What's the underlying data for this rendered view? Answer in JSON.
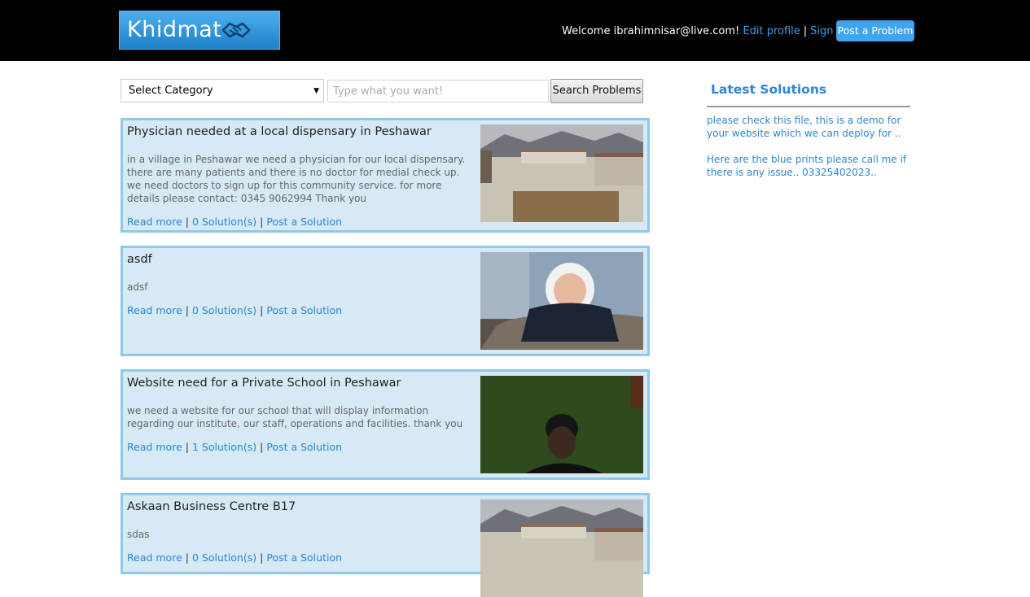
{
  "header": {
    "logo_left": "Khidmat",
    "logo_right": "gar",
    "welcome_text": "Welcome ibrahimnisar@live.com!",
    "edit_profile": "Edit profile",
    "separator": "|",
    "sign_out": "Sign out",
    "post_problem": "Post a Problem"
  },
  "search": {
    "category_selected": "Select Category",
    "placeholder": "Type what you want!",
    "button": "Search Problems"
  },
  "problems": [
    {
      "title": "Physician needed at a local dispensary in Peshawar",
      "description": "in a village in Peshawar we need a physician for our local dispensary. there are many patients and there is no doctor for medial check up. we need doctors to sign up for this community service. for more details please contact: 0345 9062994 Thank you",
      "read_more": "Read more",
      "solutions": "0 Solution(s)",
      "post_solution": "Post a Solution"
    },
    {
      "title": "asdf",
      "description": "adsf",
      "read_more": "Read more",
      "solutions": "0 Solution(s)",
      "post_solution": "Post a Solution"
    },
    {
      "title": "Website need for a Private School in Peshawar",
      "description": "we need a website for our school that will display information regarding our institute, our staff, operations and facilities. thank you",
      "read_more": "Read more",
      "solutions": "1 Solution(s)",
      "post_solution": "Post a Solution"
    },
    {
      "title": "Askaan Business Centre B17",
      "description": "sdas",
      "read_more": "Read more",
      "solutions": "0 Solution(s)",
      "post_solution": "Post a Solution"
    }
  ],
  "sidebar": {
    "title": "Latest Solutions",
    "solutions": [
      "please check this file, this is a demo for your website which we can deploy for ..",
      "Here are the blue prints please call me if there is any issue.. 03325402023.."
    ]
  },
  "colors": {
    "accent": "#2a86d6",
    "card_bg": "#d6e9f5",
    "card_border": "#8fc9ea",
    "header_bg": "#000000"
  }
}
